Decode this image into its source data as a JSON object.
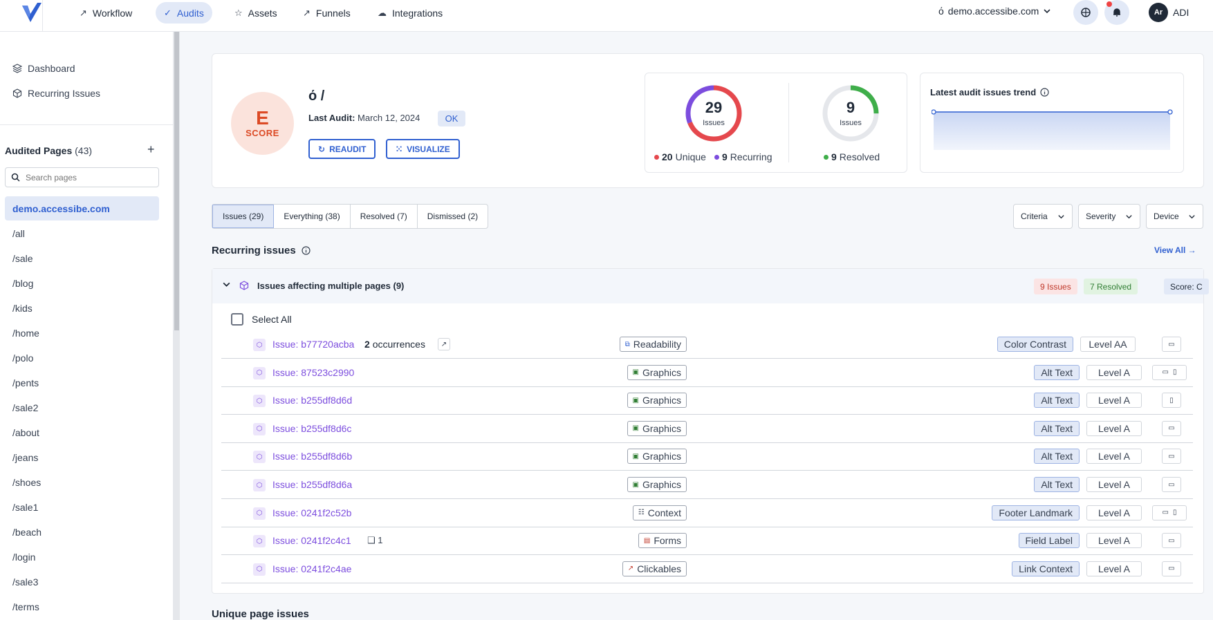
{
  "topbar": {
    "nav": [
      {
        "label": "Workflow",
        "icon": "rocket-icon"
      },
      {
        "label": "Audits",
        "icon": "check-icon",
        "active": true
      },
      {
        "label": "Assets",
        "icon": "star-icon"
      },
      {
        "label": "Funnels",
        "icon": "funnel-icon"
      },
      {
        "label": "Integrations",
        "icon": "cloud-icon"
      }
    ],
    "domain": "demo.accessibe.com",
    "domain_glyph": "ό",
    "user_initials": "Ar",
    "user_name": "ADI"
  },
  "sidebar": {
    "links": [
      {
        "label": "Dashboard"
      },
      {
        "label": "Recurring Issues"
      }
    ],
    "audited_pages_label": "Audited Pages",
    "audited_pages_count": "(43)",
    "search_placeholder": "Search pages",
    "pages": [
      "demo.accessibe.com",
      "/all",
      "/sale",
      "/blog",
      "/kids",
      "/home",
      "/polo",
      "/pents",
      "/sale2",
      "/about",
      "/jeans",
      "/shoes",
      "/sale1",
      "/beach",
      "/login",
      "/sale3",
      "/terms"
    ]
  },
  "header": {
    "score_letter": "E",
    "score_label": "SCORE",
    "site": "ό /",
    "last_audit_label": "Last Audit:",
    "last_audit_date": "March 12, 2024",
    "status": "OK",
    "reaudit": "REAUDIT",
    "visualize": "VISUALIZE",
    "issues_donut": {
      "total": "29",
      "label": "Issues",
      "unique": 20,
      "recurring": 9
    },
    "resolved_donut": {
      "total": "9",
      "label": "Issues",
      "resolved": 9
    },
    "legend": {
      "unique_num": "20",
      "unique": "Unique",
      "recurring_num": "9",
      "recurring": "Recurring",
      "resolved_num": "9",
      "resolved": "Resolved"
    },
    "trend_title": "Latest audit issues trend"
  },
  "tabs": [
    "Issues (29)",
    "Everything (38)",
    "Resolved (7)",
    "Dismissed (2)"
  ],
  "filters": [
    "Criteria",
    "Severity",
    "Device"
  ],
  "recurring": {
    "title": "Recurring issues",
    "view_all": "View All →",
    "group_title": "Issues affecting multiple pages (9)",
    "pill_issues": "9 Issues",
    "pill_resolved": "7 Resolved",
    "pill_score": "Score: C",
    "select_all": "Select All",
    "issues": [
      {
        "id": "Issue: b77720acba",
        "occ_num": "2",
        "occ": "occurrences",
        "category": "Readability",
        "criteria": "Color Contrast",
        "level": "Level AA",
        "devices": "desktop"
      },
      {
        "id": "Issue: 87523c2990",
        "category": "Graphics",
        "criteria": "Alt Text",
        "level": "Level A",
        "devices": "both"
      },
      {
        "id": "Issue: b255df8d6d",
        "category": "Graphics",
        "criteria": "Alt Text",
        "level": "Level A",
        "devices": "mobile"
      },
      {
        "id": "Issue: b255df8d6c",
        "category": "Graphics",
        "criteria": "Alt Text",
        "level": "Level A",
        "devices": "desktop"
      },
      {
        "id": "Issue: b255df8d6b",
        "category": "Graphics",
        "criteria": "Alt Text",
        "level": "Level A",
        "devices": "desktop"
      },
      {
        "id": "Issue: b255df8d6a",
        "category": "Graphics",
        "criteria": "Alt Text",
        "level": "Level A",
        "devices": "desktop"
      },
      {
        "id": "Issue: 0241f2c52b",
        "category": "Context",
        "criteria": "Footer Landmark",
        "level": "Level A",
        "devices": "both"
      },
      {
        "id": "Issue: 0241f2c4c1",
        "comments": "1",
        "category": "Forms",
        "criteria": "Field Label",
        "level": "Level A",
        "devices": "desktop"
      },
      {
        "id": "Issue: 0241f2c4ae",
        "category": "Clickables",
        "criteria": "Link Context",
        "level": "Level A",
        "devices": "desktop"
      }
    ]
  },
  "unique_title": "Unique page issues",
  "colors": {
    "accent": "#2f5fd0",
    "unique": "#e5484d",
    "recurring": "#7c4dde",
    "resolved": "#3fae4a",
    "score": "#dc4a25"
  }
}
